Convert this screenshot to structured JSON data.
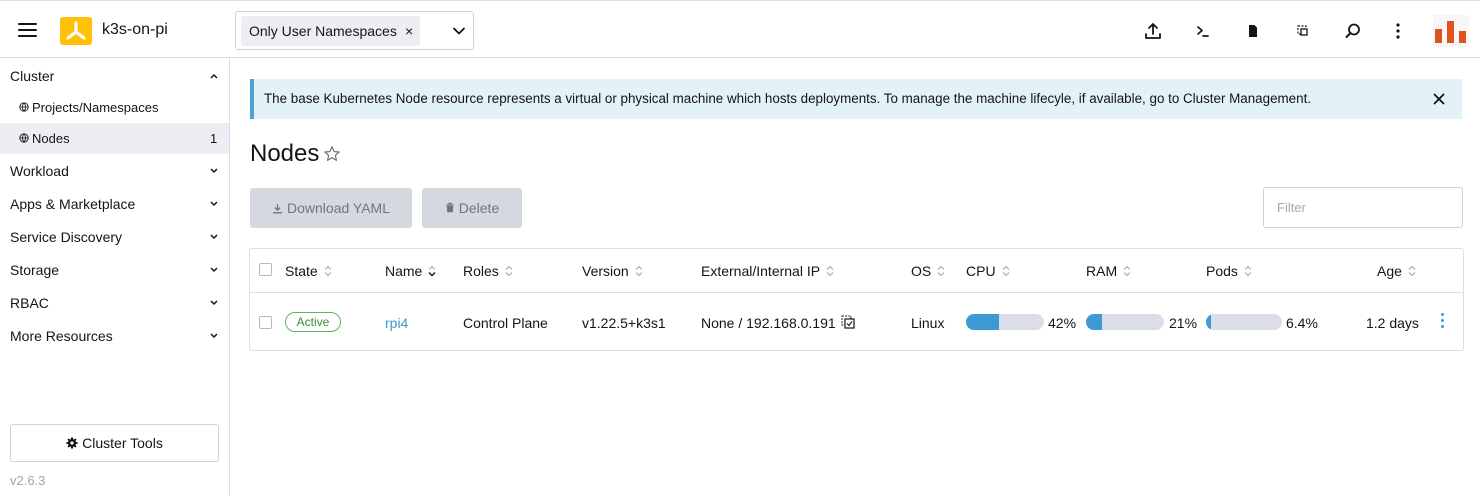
{
  "header": {
    "cluster_name": "k3s-on-pi",
    "namespace_filter": "Only User Namespaces",
    "namespace_remove": "×",
    "icons": [
      "upload-icon",
      "terminal-icon",
      "file-icon",
      "copy-icon",
      "search-icon",
      "more-vertical-icon"
    ]
  },
  "sidebar": {
    "groups": [
      {
        "label": "Cluster",
        "expanded": true
      },
      {
        "label": "Workload"
      },
      {
        "label": "Apps & Marketplace"
      },
      {
        "label": "Service Discovery"
      },
      {
        "label": "Storage"
      },
      {
        "label": "RBAC"
      },
      {
        "label": "More Resources"
      }
    ],
    "cluster_items": [
      {
        "label": "Projects/Namespaces",
        "count": ""
      },
      {
        "label": "Nodes",
        "count": "1",
        "active": true
      }
    ],
    "tools_label": "Cluster Tools",
    "version": "v2.6.3"
  },
  "banner": {
    "text": "The base Kubernetes Node resource represents a virtual or physical machine which hosts deployments. To manage the machine lifecyle, if available, go to Cluster Management."
  },
  "page": {
    "title": "Nodes",
    "download_label": "Download YAML",
    "delete_label": "Delete",
    "filter_placeholder": "Filter"
  },
  "table": {
    "columns": [
      "State",
      "Name",
      "Roles",
      "Version",
      "External/Internal IP",
      "OS",
      "CPU",
      "RAM",
      "Pods",
      "Age"
    ],
    "rows": [
      {
        "state": "Active",
        "name": "rpi4",
        "roles": "Control Plane",
        "version": "v1.22.5+k3s1",
        "ip": "None / 192.168.0.191",
        "os": "Linux",
        "cpu": "42%",
        "cpu_fraction": 0.42,
        "ram": "21%",
        "ram_fraction": 0.21,
        "pods": "6.4%",
        "pods_fraction": 0.064,
        "age": "1.2 days"
      }
    ]
  },
  "colors": {
    "accent": "#3d98d3",
    "active_badge": "#5cb85c",
    "banner_bg": "#e3f1f9",
    "logo": "#ffc107"
  }
}
